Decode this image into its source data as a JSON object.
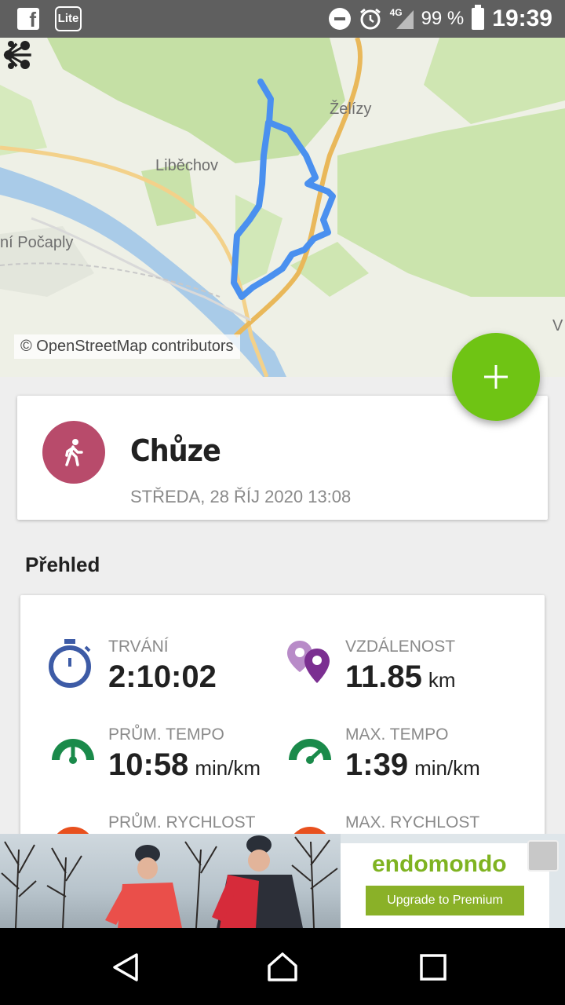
{
  "status_bar": {
    "icons": [
      "facebook-icon",
      "app-icon",
      "do-not-disturb-icon",
      "alarm-icon",
      "signal-icon",
      "battery-icon"
    ],
    "app_icon_text": "Lite",
    "network": "4G",
    "battery": "99 %",
    "time": "19:39"
  },
  "map": {
    "labels": {
      "zelizy": "Želízy",
      "libechov": "Liběchov",
      "pocaply": "ní Počaply",
      "edge": "V"
    },
    "credit": "© OpenStreetMap contributors",
    "route_color": "#4a90ef"
  },
  "toolbar": {
    "back_icon": "back-arrow-icon",
    "share_icon": "share-icon",
    "more_icon": "more-vert-icon"
  },
  "fab": {
    "icon": "plus-icon",
    "color": "#6fc414"
  },
  "workout": {
    "sport": "Chůze",
    "date": "STŘEDA, 28 ŘÍJ 2020 13:08",
    "sport_icon": "walking-icon",
    "avatar_color": "#b84b6b"
  },
  "overview": {
    "title": "Přehled",
    "stats": [
      {
        "label": "TRVÁNÍ",
        "value": "2:10:02",
        "unit": "",
        "icon": "stopwatch-icon"
      },
      {
        "label": "VZDÁLENOST",
        "value": "11.85",
        "unit": "km",
        "icon": "location-pins-icon"
      },
      {
        "label": "PRŮM. TEMPO",
        "value": "10:58",
        "unit": "min/km",
        "icon": "speedometer-icon"
      },
      {
        "label": "MAX. TEMPO",
        "value": "1:39",
        "unit": "min/km",
        "icon": "speedometer-icon"
      },
      {
        "label": "PRŮM. RYCHLOST",
        "value": "",
        "unit": "",
        "icon": "speed-icon"
      },
      {
        "label": "MAX. RYCHLOST",
        "value": "",
        "unit": "",
        "icon": "speed-icon"
      }
    ]
  },
  "ad": {
    "brand": "endomondo",
    "cta": "Upgrade to Premium"
  },
  "nav": {
    "icons": [
      "nav-back-icon",
      "nav-home-icon",
      "nav-recents-icon"
    ]
  }
}
